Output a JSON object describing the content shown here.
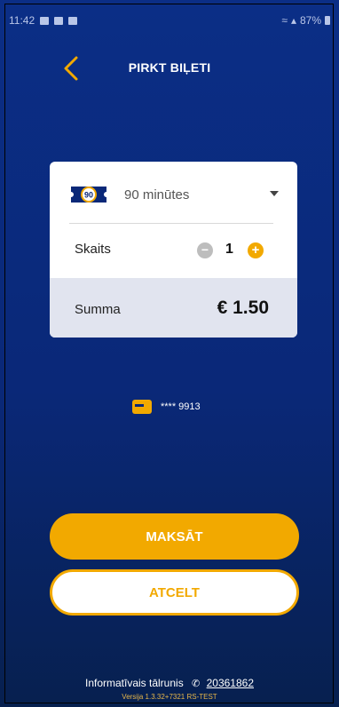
{
  "status_bar": {
    "time": "11:42",
    "battery": "87%"
  },
  "header": {
    "title": "PIRKT BIĻETI"
  },
  "ticket": {
    "icon_label": "90",
    "name": "90 minūtes"
  },
  "count": {
    "label": "Skaits",
    "value": "1",
    "minus": "−",
    "plus": "+"
  },
  "sum": {
    "label": "Summa",
    "value": "€ 1.50"
  },
  "payment_card": {
    "masked": "**** 9913"
  },
  "buttons": {
    "pay": "MAKSĀT",
    "cancel": "ATCELT"
  },
  "footer": {
    "phone_label": "Informatīvais tālrunis",
    "phone_number": "20361862",
    "version": "Versija 1.3.32+7321 RS-TEST"
  },
  "colors": {
    "accent": "#f2a900",
    "background": "#0a2878",
    "card": "#ffffff",
    "sum_background": "#e1e4ef"
  }
}
